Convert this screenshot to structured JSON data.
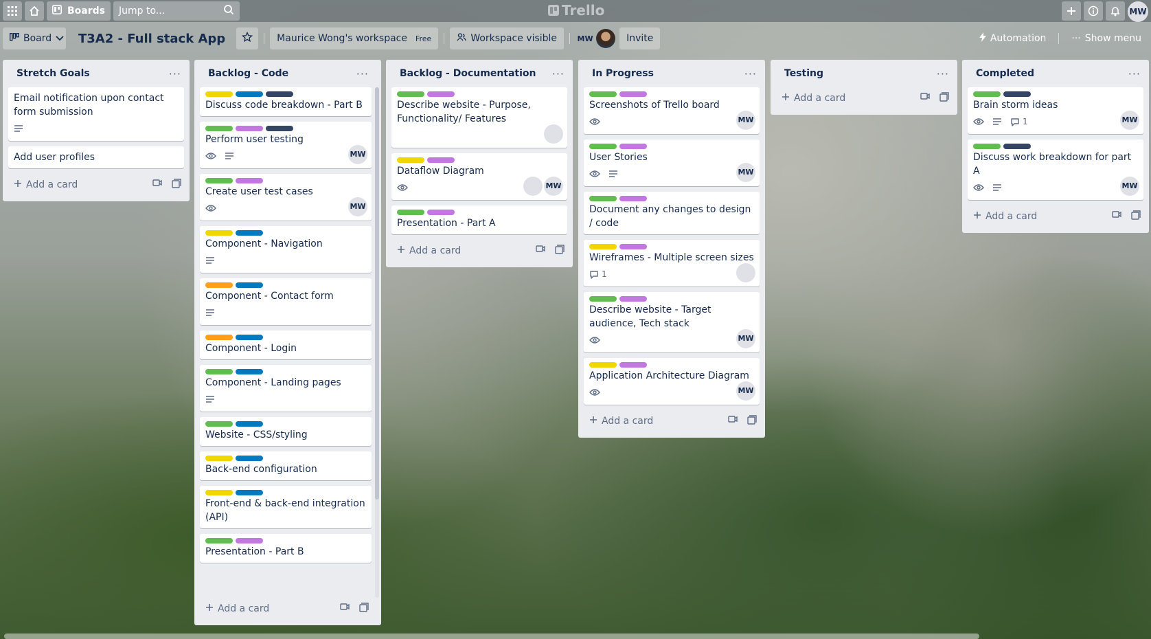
{
  "topnav": {
    "boards_label": "Boards",
    "search_placeholder": "Jump to...",
    "logo_text": "Trello",
    "user_initials": "MW"
  },
  "header": {
    "view_label": "Board",
    "board_title": "T3A2 - Full stack App",
    "workspace": "Maurice Wong's workspace",
    "plan": "Free",
    "visibility": "Workspace visible",
    "member_initials": "MW",
    "invite": "Invite",
    "automation": "Automation",
    "show_menu": "Show menu"
  },
  "colors": {
    "green": "#61bd4f",
    "purple": "#c377e0",
    "blue": "#0079bf",
    "navy": "#344563",
    "yellow": "#f2d600",
    "orange": "#ff9f1a"
  },
  "add_card_label": "Add a card",
  "lists": [
    {
      "title": "Stretch Goals",
      "cards": [
        {
          "title": "Email notification upon contact form submission",
          "labels": [],
          "badges": [
            "desc"
          ],
          "members": []
        },
        {
          "title": "Add user profiles",
          "labels": [],
          "badges": [],
          "members": []
        }
      ]
    },
    {
      "title": "Backlog - Code",
      "cards": [
        {
          "title": "Discuss code breakdown - Part B",
          "labels": [
            "yellow",
            "blue",
            "navy"
          ],
          "badges": [],
          "members": []
        },
        {
          "title": "Perform user testing",
          "labels": [
            "green",
            "purple",
            "navy"
          ],
          "badges": [
            "watch",
            "desc"
          ],
          "members": [
            "MW"
          ]
        },
        {
          "title": "Create user test cases",
          "labels": [
            "green",
            "purple"
          ],
          "badges": [
            "watch"
          ],
          "members": [
            "MW"
          ]
        },
        {
          "title": "Component - Navigation",
          "labels": [
            "yellow",
            "blue"
          ],
          "badges": [
            "desc"
          ],
          "members": []
        },
        {
          "title": "Component - Contact form",
          "labels": [
            "orange",
            "blue"
          ],
          "badges": [
            "desc"
          ],
          "members": []
        },
        {
          "title": "Component - Login",
          "labels": [
            "orange",
            "blue"
          ],
          "badges": [],
          "members": []
        },
        {
          "title": "Component - Landing pages",
          "labels": [
            "green",
            "blue"
          ],
          "badges": [
            "desc"
          ],
          "members": []
        },
        {
          "title": "Website - CSS/styling",
          "labels": [
            "green",
            "blue"
          ],
          "badges": [],
          "members": []
        },
        {
          "title": "Back-end configuration",
          "labels": [
            "yellow",
            "blue"
          ],
          "badges": [],
          "members": []
        },
        {
          "title": "Front-end & back-end integration (API)",
          "labels": [
            "yellow",
            "blue"
          ],
          "badges": [],
          "members": []
        },
        {
          "title": "Presentation - Part B",
          "labels": [
            "green",
            "purple"
          ],
          "badges": [],
          "members": []
        }
      ]
    },
    {
      "title": "Backlog - Documentation",
      "cards": [
        {
          "title": "Describe website - Purpose, Functionality/ Features",
          "labels": [
            "green",
            "purple"
          ],
          "badges": [],
          "members": [
            "photo"
          ]
        },
        {
          "title": "Dataflow Diagram",
          "labels": [
            "yellow",
            "purple"
          ],
          "badges": [
            "watch"
          ],
          "members": [
            "photo",
            "MW"
          ]
        },
        {
          "title": "Presentation - Part A",
          "labels": [
            "green",
            "purple"
          ],
          "badges": [],
          "members": []
        }
      ]
    },
    {
      "title": "In Progress",
      "cards": [
        {
          "title": "Screenshots of Trello board",
          "labels": [
            "green",
            "purple"
          ],
          "badges": [
            "watch"
          ],
          "members": [
            "MW"
          ]
        },
        {
          "title": "User Stories",
          "labels": [
            "green",
            "purple"
          ],
          "badges": [
            "watch",
            "desc"
          ],
          "members": [
            "MW"
          ]
        },
        {
          "title": "Document any changes to design / code",
          "labels": [
            "green",
            "purple"
          ],
          "badges": [],
          "members": []
        },
        {
          "title": "Wireframes - Multiple screen sizes",
          "labels": [
            "yellow",
            "purple"
          ],
          "badges": [
            "comment:1"
          ],
          "members": [
            "photo"
          ]
        },
        {
          "title": "Describe website - Target audience, Tech stack",
          "labels": [
            "green",
            "purple"
          ],
          "badges": [
            "watch"
          ],
          "members": [
            "MW"
          ]
        },
        {
          "title": "Application Architecture Diagram",
          "labels": [
            "yellow",
            "purple"
          ],
          "badges": [
            "watch"
          ],
          "members": [
            "MW"
          ]
        }
      ]
    },
    {
      "title": "Testing",
      "cards": []
    },
    {
      "title": "Completed",
      "cards": [
        {
          "title": "Brain storm ideas",
          "labels": [
            "green",
            "navy"
          ],
          "badges": [
            "watch",
            "desc",
            "comment:1"
          ],
          "members": [
            "MW"
          ]
        },
        {
          "title": "Discuss work breakdown for part A",
          "labels": [
            "green",
            "navy"
          ],
          "badges": [
            "watch",
            "desc"
          ],
          "members": [
            "MW"
          ]
        }
      ]
    }
  ]
}
